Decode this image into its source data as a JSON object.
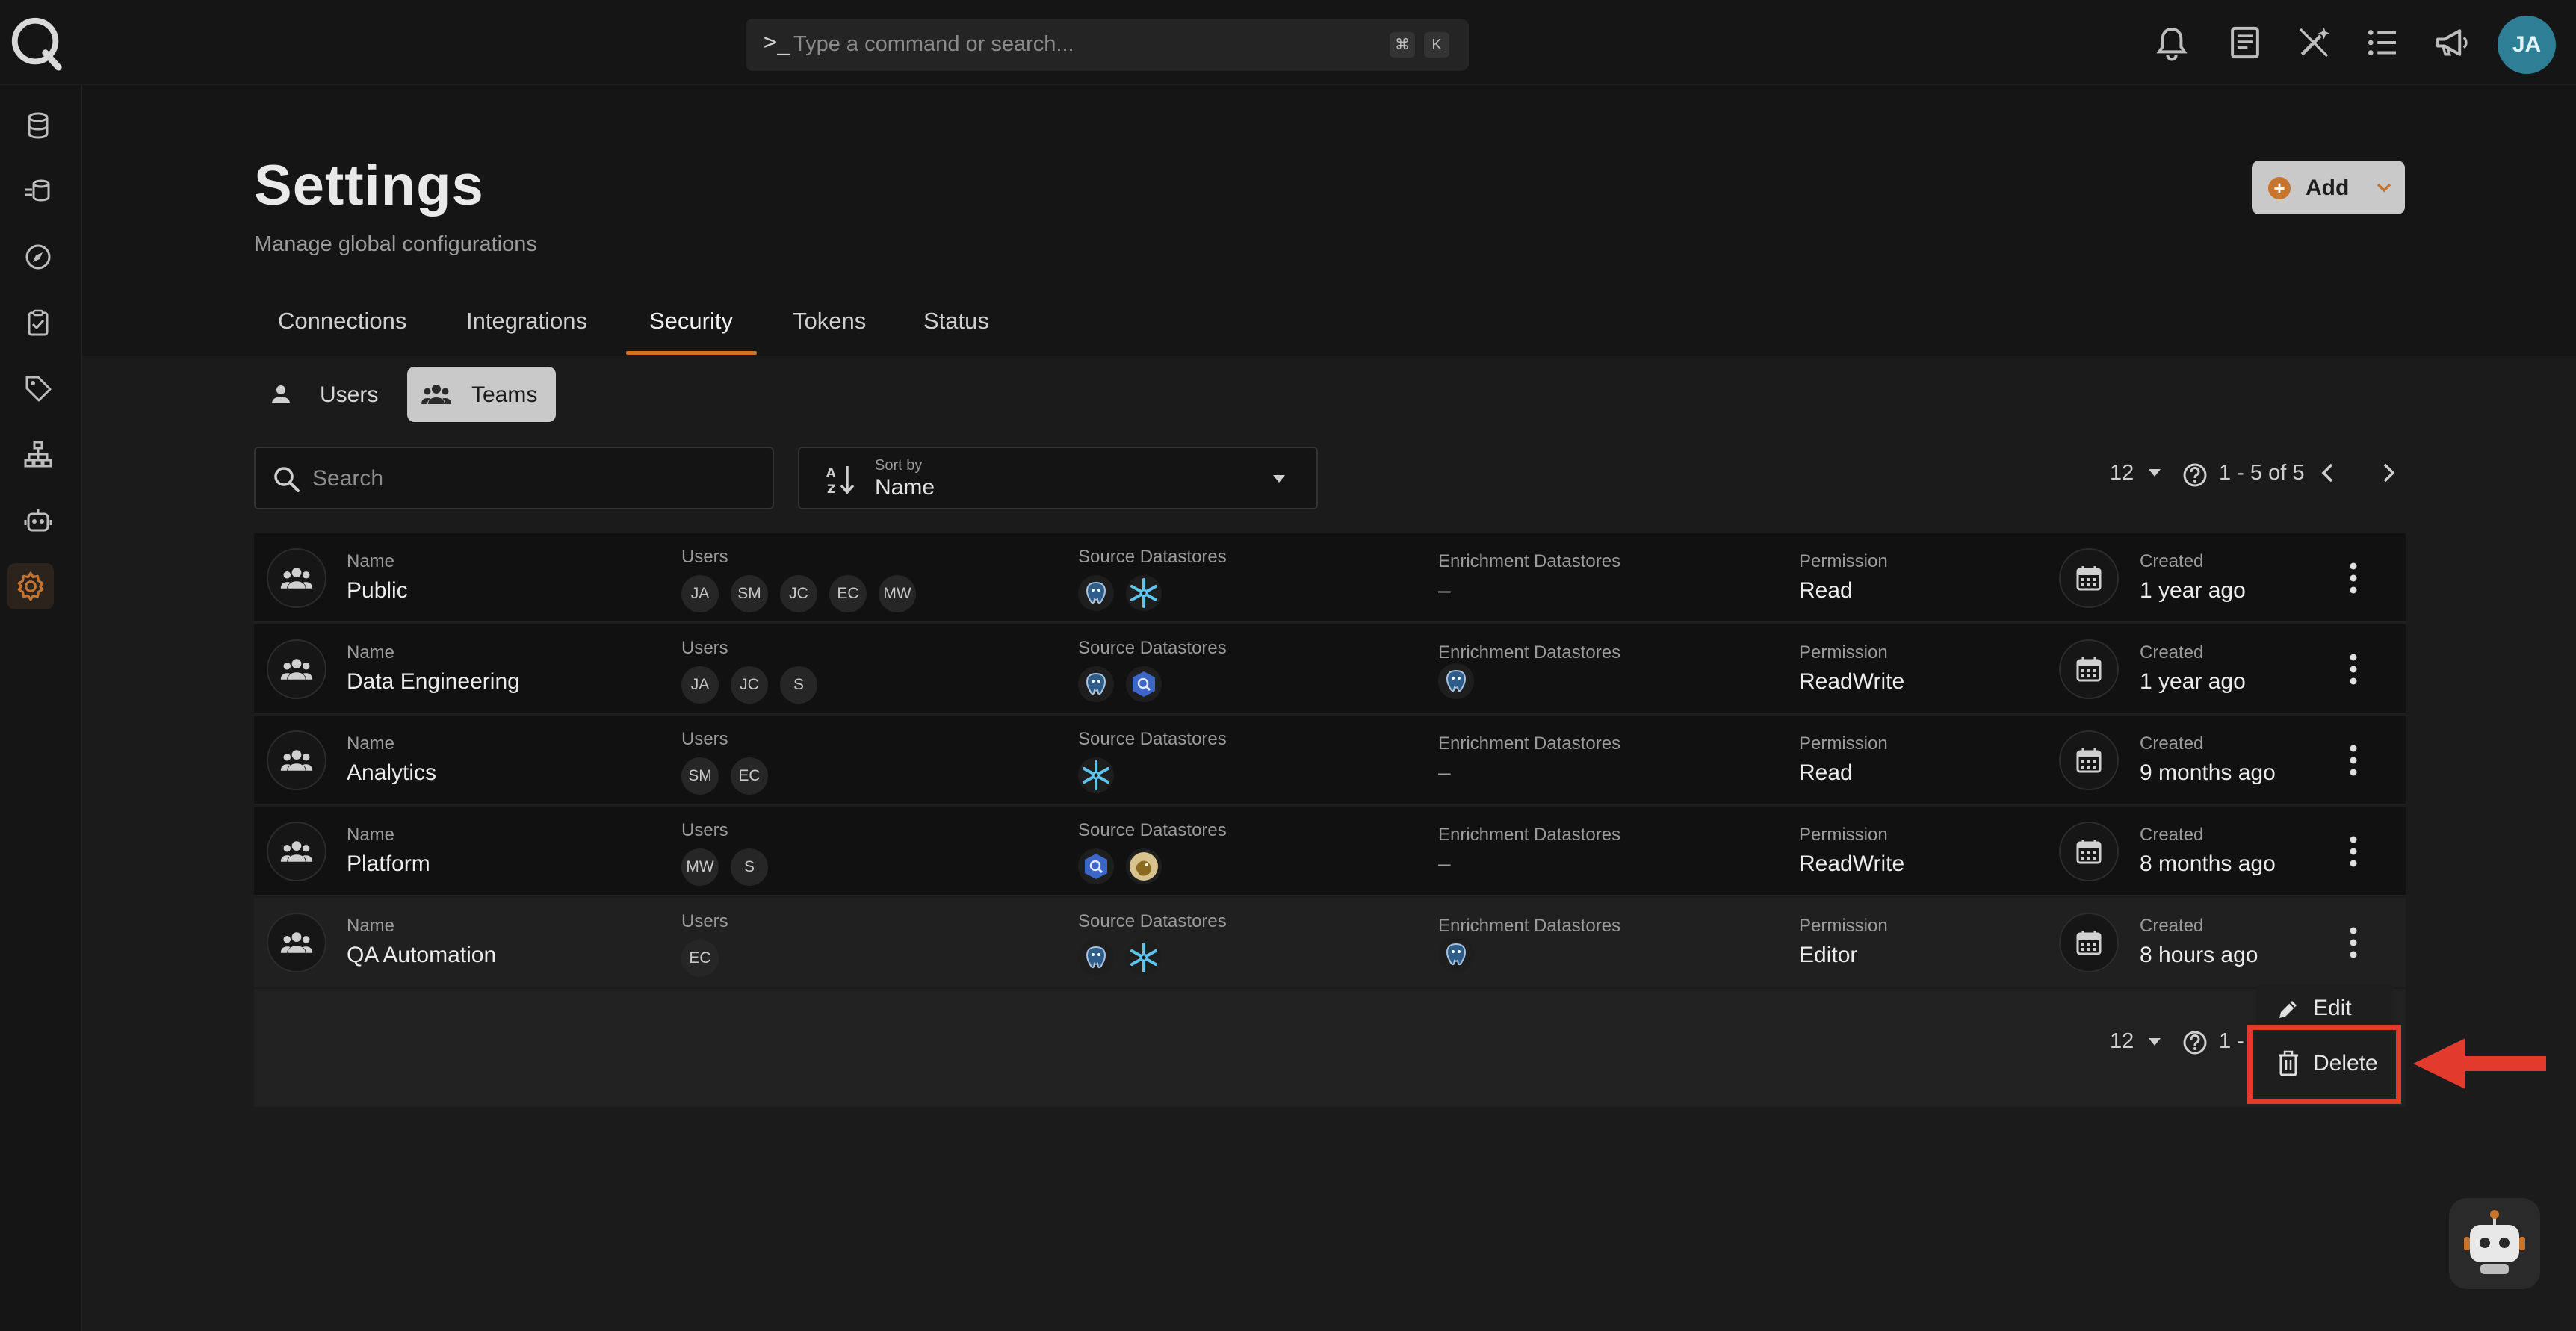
{
  "topbar": {
    "command_placeholder": "Type a command or search...",
    "shortcut_keys": [
      "⌘",
      "K"
    ],
    "avatar_initials": "JA",
    "icons": [
      "bell-icon",
      "document-icon",
      "magic-wand-off-icon",
      "list-icon",
      "megaphone-icon"
    ]
  },
  "sidebar": {
    "items": [
      "database-icon",
      "stacked-datastore-icon",
      "compass-icon",
      "clipboard-check-icon",
      "tag-icon",
      "hierarchy-icon",
      "robot-icon",
      "settings-icon"
    ],
    "active": "settings-icon"
  },
  "header": {
    "title": "Settings",
    "subtitle": "Manage global configurations",
    "add_label": "Add"
  },
  "tabs": [
    {
      "label": "Connections"
    },
    {
      "label": "Integrations"
    },
    {
      "label": "Security",
      "active": true
    },
    {
      "label": "Tokens"
    },
    {
      "label": "Status"
    }
  ],
  "subtabs": [
    {
      "label": "Users"
    },
    {
      "label": "Teams",
      "active": true
    }
  ],
  "filters": {
    "search_placeholder": "Search",
    "sort_caption": "Sort by",
    "sort_value": "Name"
  },
  "pagination": {
    "page_size": "12",
    "range": "1 - 5 of 5",
    "range_partial": "1 -"
  },
  "columns": {
    "name": "Name",
    "users": "Users",
    "source": "Source Datastores",
    "enrichment": "Enrichment Datastores",
    "permission": "Permission",
    "created": "Created"
  },
  "rows": [
    {
      "name": "Public",
      "users": [
        "JA",
        "SM",
        "JC",
        "EC",
        "MW"
      ],
      "source": [
        "postgres",
        "snowflake"
      ],
      "enrichment_text": "–",
      "enrichment": [],
      "permission": "Read",
      "created": "1 year ago"
    },
    {
      "name": "Data Engineering",
      "users": [
        "JA",
        "JC",
        "S"
      ],
      "source": [
        "postgres",
        "bigquery"
      ],
      "enrichment_text": "",
      "enrichment": [
        "postgres"
      ],
      "permission": "ReadWrite",
      "created": "1 year ago"
    },
    {
      "name": "Analytics",
      "users": [
        "SM",
        "EC"
      ],
      "source": [
        "snowflake"
      ],
      "enrichment_text": "–",
      "enrichment": [],
      "permission": "Read",
      "created": "9 months ago"
    },
    {
      "name": "Platform",
      "users": [
        "MW",
        "S"
      ],
      "source": [
        "bigquery",
        "hive"
      ],
      "enrichment_text": "–",
      "enrichment": [],
      "permission": "ReadWrite",
      "created": "8 months ago"
    },
    {
      "name": "QA Automation",
      "users": [
        "EC"
      ],
      "source": [
        "postgres",
        "snowflake"
      ],
      "enrichment_text": "",
      "enrichment": [
        "postgres"
      ],
      "permission": "Editor",
      "created": "8 hours ago"
    }
  ],
  "menu": {
    "edit_label": "Edit",
    "delete_label": "Delete"
  },
  "colors": {
    "accent": "#c6742e",
    "annotation_red": "#e23a2c",
    "avatar": "#2e7e95"
  }
}
